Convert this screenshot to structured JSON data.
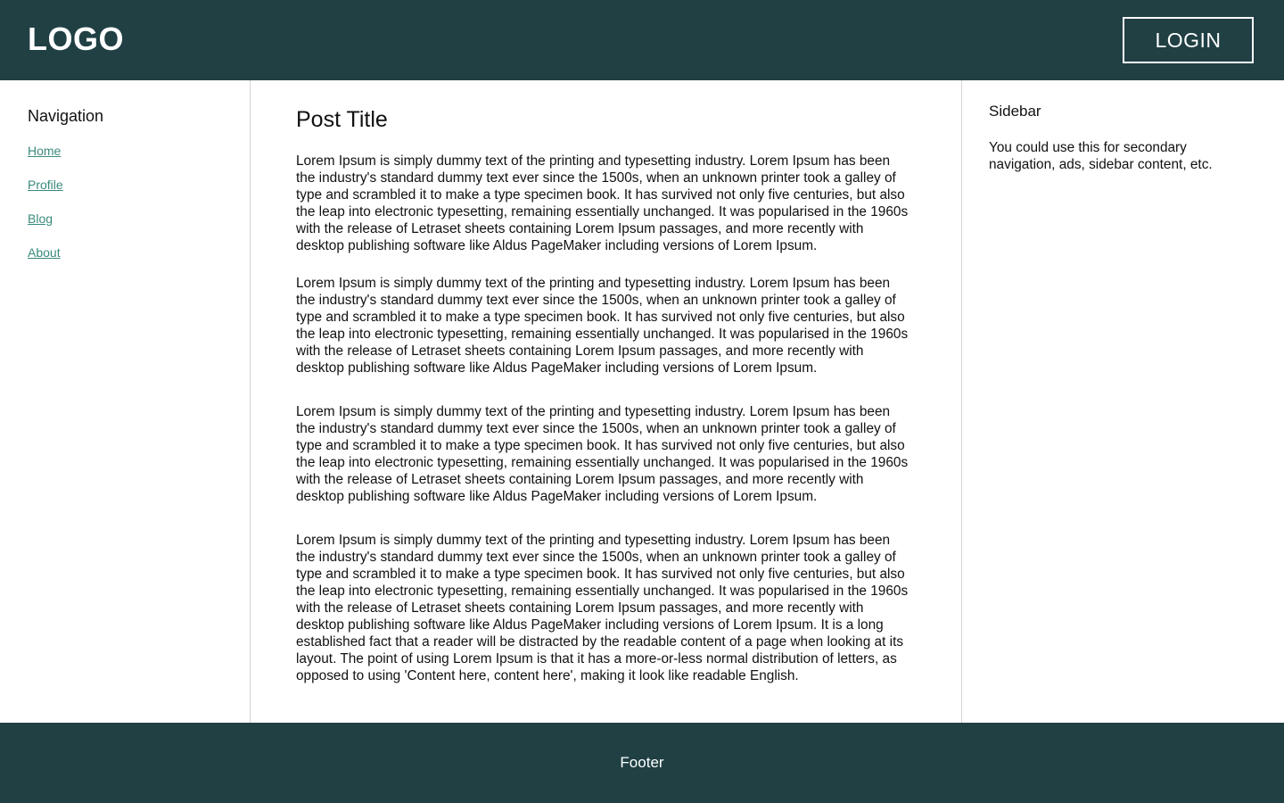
{
  "header": {
    "logo": "LOGO",
    "login_label": "LOGIN"
  },
  "nav": {
    "heading": "Navigation",
    "items": [
      {
        "label": "Home"
      },
      {
        "label": "Profile"
      },
      {
        "label": "Blog"
      },
      {
        "label": "About"
      }
    ]
  },
  "main": {
    "title": "Post Title",
    "paragraphs": [
      "Lorem Ipsum is simply dummy text of the printing and typesetting industry. Lorem Ipsum has been the industry's standard dummy text ever since the 1500s, when an unknown printer took a galley of type and scrambled it to make a type specimen book. It has survived not only five centuries, but also the leap into electronic typesetting, remaining essentially unchanged. It was popularised in the 1960s with the release of Letraset sheets containing Lorem Ipsum passages, and more recently with desktop publishing software like Aldus PageMaker including versions of Lorem Ipsum.",
      "Lorem Ipsum is simply dummy text of the printing and typesetting industry. Lorem Ipsum has been the industry's standard dummy text ever since the 1500s, when an unknown printer took a galley of type and scrambled it to make a type specimen book. It has survived not only five centuries, but also the leap into electronic typesetting, remaining essentially unchanged. It was popularised in the 1960s with the release of Letraset sheets containing Lorem Ipsum passages, and more recently with desktop publishing software like Aldus PageMaker including versions of Lorem Ipsum.",
      "Lorem Ipsum is simply dummy text of the printing and typesetting industry. Lorem Ipsum has been the industry's standard dummy text ever since the 1500s, when an unknown printer took a galley of type and scrambled it to make a type specimen book. It has survived not only five centuries, but also the leap into electronic typesetting, remaining essentially unchanged. It was popularised in the 1960s with the release of Letraset sheets containing Lorem Ipsum passages, and more recently with desktop publishing software like Aldus PageMaker including versions of Lorem Ipsum.",
      "Lorem Ipsum is simply dummy text of the printing and typesetting industry. Lorem Ipsum has been the industry's standard dummy text ever since the 1500s, when an unknown printer took a galley of type and scrambled it to make a type specimen book. It has survived not only five centuries, but also the leap into electronic typesetting, remaining essentially unchanged. It was popularised in the 1960s with the release of Letraset sheets containing Lorem Ipsum passages, and more recently with desktop publishing software like Aldus PageMaker including versions of Lorem Ipsum.  It is a long established fact that a reader will be distracted by the readable content of a page when looking at its layout. The point of using Lorem Ipsum is that it has a more-or-less normal distribution of letters, as opposed to using 'Content here, content here', making it look like readable English."
    ]
  },
  "sidebar": {
    "title": "Sidebar",
    "text": "You could use this for secondary navigation, ads, sidebar content, etc."
  },
  "footer": {
    "text": "Footer"
  },
  "colors": {
    "header_bg": "#204044",
    "footer_bg": "#204044",
    "link": "#3a8a7d",
    "divider": "#d4d4d4"
  }
}
